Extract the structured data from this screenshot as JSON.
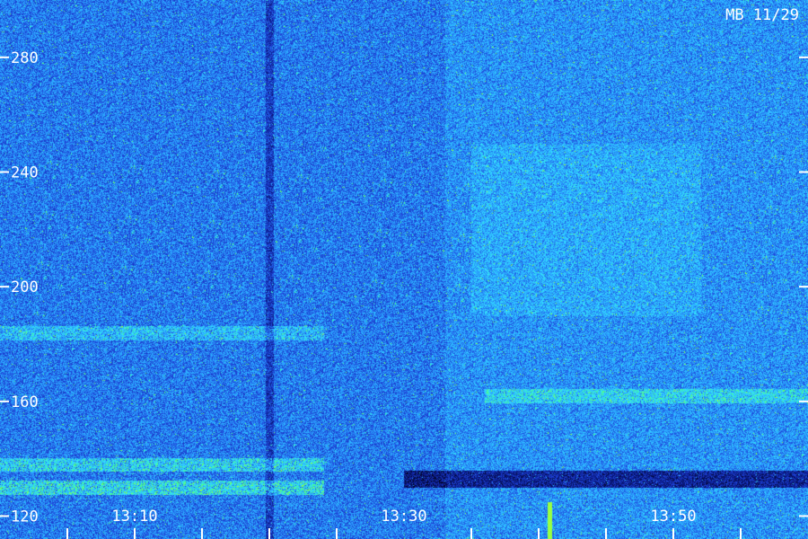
{
  "chart_data": {
    "type": "heatmap",
    "title": "MB 11/29",
    "xlabel": "",
    "ylabel": "",
    "y_ticks": [
      {
        "value": 280,
        "label": "280"
      },
      {
        "value": 240,
        "label": "240"
      },
      {
        "value": 200,
        "label": "200"
      },
      {
        "value": 160,
        "label": "160"
      },
      {
        "value": 120,
        "label": "120"
      }
    ],
    "ylim": [
      112,
      300
    ],
    "x_time_labels": [
      {
        "minutes": 10,
        "label": "13:10"
      },
      {
        "minutes": 30,
        "label": "13:30"
      },
      {
        "minutes": 50,
        "label": "13:50"
      }
    ],
    "xlim_minutes": [
      0,
      60
    ],
    "x_minor_tick_minutes": [
      5,
      10,
      15,
      20,
      25,
      35,
      40,
      45,
      50,
      55
    ],
    "colormap": [
      "#000010",
      "#0a1a8a",
      "#1e44d8",
      "#2aa0ff",
      "#33e0ff",
      "#44ff88",
      "#aaff33"
    ],
    "features": [
      {
        "kind": "band",
        "freq": 184,
        "time_start": 0,
        "time_end": 24,
        "intensity": 0.55
      },
      {
        "kind": "band",
        "freq": 138,
        "time_start": 0,
        "time_end": 24,
        "intensity": 0.75
      },
      {
        "kind": "band",
        "freq": 130,
        "time_start": 0,
        "time_end": 24,
        "intensity": 0.85
      },
      {
        "kind": "band",
        "freq": 162,
        "time_start": 36,
        "time_end": 60,
        "intensity": 0.6
      },
      {
        "kind": "dark_band",
        "freq": 133,
        "time_start": 30,
        "time_end": 60,
        "intensity": 0.8
      },
      {
        "kind": "dark_column",
        "time": 20,
        "intensity": 0.6
      },
      {
        "kind": "bright_region",
        "freq_start": 190,
        "freq_end": 250,
        "time_start": 35,
        "time_end": 52,
        "intensity": 0.35
      },
      {
        "kind": "spike",
        "time": 40.8,
        "freq_start": 112,
        "freq_end": 125,
        "intensity": 1.0
      }
    ]
  }
}
